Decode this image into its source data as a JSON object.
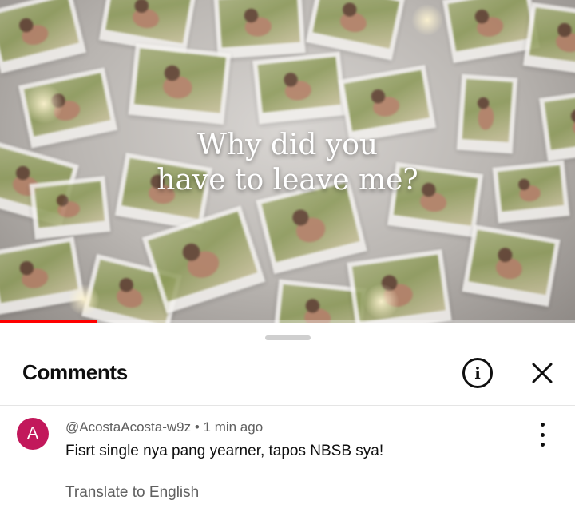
{
  "video": {
    "overlay_line1": "Why did you",
    "overlay_line2": "have to leave me?",
    "progress": 0.17,
    "progress_color": "#ff0000"
  },
  "comments_panel": {
    "title": "Comments",
    "info_icon": "info-icon",
    "close_icon": "close-icon"
  },
  "comment": {
    "avatar_letter": "A",
    "avatar_color": "#c2185b",
    "author": "@AcostaAcosta-w9z",
    "separator": "•",
    "time": "1 min ago",
    "text": "Fisrt single nya pang yearner, tapos NBSB sya!",
    "translate_label": "Translate to English",
    "menu_icon": "more-vert-icon"
  }
}
